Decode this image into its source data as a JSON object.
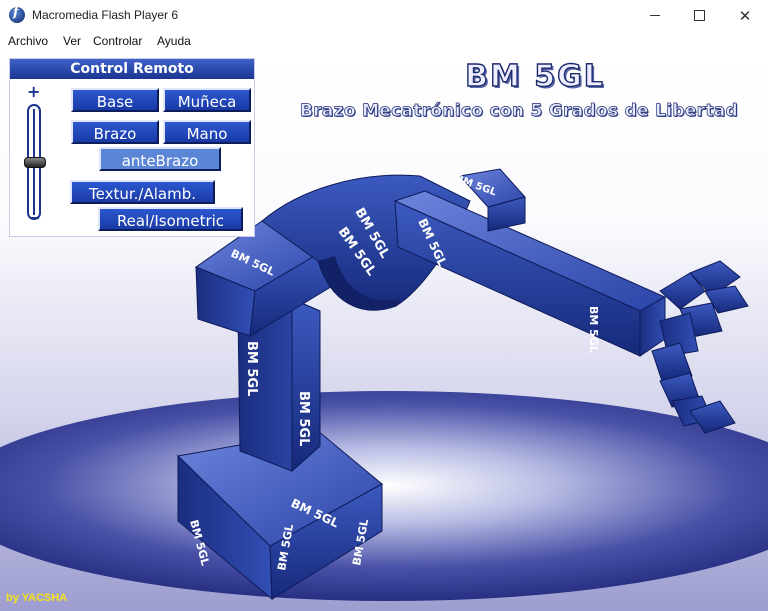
{
  "window": {
    "title": "Macromedia Flash Player 6"
  },
  "menu": [
    "Archivo",
    "Ver",
    "Controlar",
    "Ayuda"
  ],
  "stage": {
    "title": "BM 5GL",
    "subtitle": "Brazo Mecatrónico con 5 Grados de Libertad",
    "credit": "by YACSHA",
    "label": "BM 5GL"
  },
  "panel": {
    "title": "Control Remoto",
    "slider_plus": "+",
    "buttons": {
      "base": "Base",
      "muneca": "Muñeca",
      "brazo": "Brazo",
      "mano": "Mano",
      "antebrazo": "anteBrazo",
      "textura": "Textur./Alamb.",
      "vista": "Real/Isometric"
    }
  },
  "colors": {
    "arm_blue": "#2a3f9f",
    "arm_dark": "#15246b",
    "panel_blue": "#1b3590",
    "credit_yellow": "#f6e21a"
  },
  "icons": {
    "app": "flash-player-icon",
    "minimize": "minimize-icon",
    "maximize": "maximize-icon",
    "close": "close-icon"
  }
}
